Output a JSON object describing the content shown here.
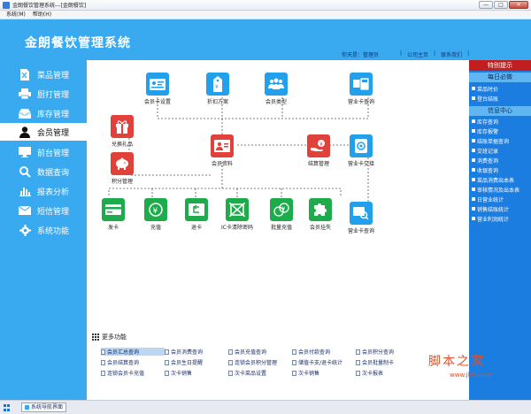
{
  "window": {
    "title": "金朗餐饮管理系统---[金朗餐饮]",
    "min": "—",
    "max": "□",
    "close": "✕"
  },
  "menubar": {
    "items": [
      "系统(M)",
      "帮助(H)"
    ]
  },
  "header": {
    "app_title": "金朗餐饮管理系统",
    "welcome": "你天是：管理员",
    "links": [
      "公司主页",
      "联系我们"
    ]
  },
  "sidebar": {
    "active_index": 3,
    "items": [
      {
        "label": "菜品管理",
        "icon": "file-icon"
      },
      {
        "label": "厨打管理",
        "icon": "printer-icon"
      },
      {
        "label": "库存管理",
        "icon": "inbox-icon"
      },
      {
        "label": "会员管理",
        "icon": "user-icon"
      },
      {
        "label": "前台管理",
        "icon": "monitor-icon"
      },
      {
        "label": "数据查询",
        "icon": "search-icon"
      },
      {
        "label": "报表分析",
        "icon": "bar-chart-icon"
      },
      {
        "label": "短信管理",
        "icon": "envelope-icon"
      },
      {
        "label": "系统功能",
        "icon": "gear-icon"
      }
    ]
  },
  "flow": {
    "nodes": {
      "member_card_setup": "会员卡设置",
      "discount_plan": "折扣方案",
      "member_type": "会员类型",
      "business_card_query": "营业卡查询",
      "gift_redeem": "兑换礼品",
      "points_manage": "积分管理",
      "member_info": "会员资料",
      "settle_manage": "结算管理",
      "business_card_interface": "营业卡交接",
      "issue_card": "发卡",
      "recharge": "充值",
      "return_card": "退卡",
      "ic_card_password": "IC卡清除密码",
      "batch_recharge": "批量充值",
      "member_report_loss": "会员挂失",
      "business_card_search": "营业卡查询"
    }
  },
  "more": {
    "title": "更多功能",
    "items": [
      "会员汇总查询",
      "会员消费查询",
      "会员充值查询",
      "会员付款查询",
      "会员积分查询",
      "会员结算查询",
      "会员生日提醒",
      "连锁会员积分管理",
      "储值卡支/退卡统计",
      "会员批量制卡",
      "连锁会员卡充值",
      "次卡销售",
      "次卡菜品设置",
      "次卡销售",
      "次卡报表"
    ]
  },
  "right_panel": {
    "header": "特别提示",
    "section1": "每日必做",
    "section1_items": [
      "菜品时价",
      "登台结账"
    ],
    "section2": "信息中心",
    "section2_items": [
      "库存查询",
      "库存报警",
      "结账单据查询",
      "交班记录",
      "消费查询",
      "收银查询",
      "菜品消费出本表",
      "审核情况及出本表",
      "日营业统计",
      "销售结账统计",
      "营业利润统计"
    ]
  },
  "statusbar": {
    "tab": "系统导航界面"
  },
  "watermark": {
    "line1": "脚本之家",
    "line2": "www.jb51.net"
  },
  "colors": {
    "header_blue": "#3aaaf0",
    "panel_blue": "#1c7de0",
    "alert_red": "#c11f1f",
    "node_blue": "#23a0ec",
    "node_red": "#e0413a",
    "node_green": "#1eab4c"
  }
}
